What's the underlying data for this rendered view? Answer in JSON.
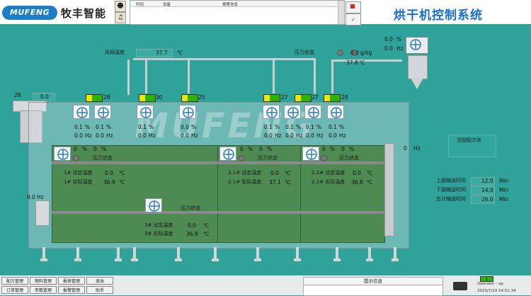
{
  "header": {
    "logo_text": "MUFENG",
    "brand_cn": "牧丰智能",
    "system_title": "烘干机控制系统",
    "alarm_columns": [
      "时间",
      "设备",
      "报警信息"
    ],
    "ack_icons": [
      "user-icon",
      "bell-icon"
    ]
  },
  "pipeline": {
    "wind_label": "风网温度",
    "wind_temp": "37.7",
    "wind_unit": "℃",
    "pressure_label": "压力状态",
    "pressure_value": "0.0",
    "pressure_unit": "g/kg",
    "exhaust_temp": "37.8",
    "exhaust_unit": "℃",
    "exhaust_pct": "0.0",
    "exhaust_hz": "0.0",
    "pct_unit": "%",
    "hz_unit": "Hz"
  },
  "feeder": {
    "id": "28",
    "value": "0.0"
  },
  "lamps": [
    {
      "num": "28"
    },
    {
      "num": "30"
    },
    {
      "num": "25"
    },
    {
      "num": "27"
    },
    {
      "num": "27"
    },
    {
      "num": "28"
    }
  ],
  "fans_top": [
    {
      "pct": "0.1",
      "hz": "0.0"
    },
    {
      "pct": "0.1",
      "hz": "0.0"
    },
    {
      "pct": "0.1",
      "hz": "0.0"
    },
    {
      "pct": "0.0",
      "hz": "0.0"
    },
    {
      "pct": "0.1",
      "hz": "0.0"
    },
    {
      "pct": "0.1",
      "hz": "0.0"
    },
    {
      "pct": "0.1",
      "hz": "0.0"
    },
    {
      "pct": "0.1",
      "hz": "0.0"
    }
  ],
  "zones": [
    {
      "fan_a": "0",
      "fan_b": "0",
      "pressure": "压力状态",
      "set_label": "1# 设定温度",
      "set": "0.0",
      "act_label": "1# 实际温度",
      "act": "36.9"
    },
    {
      "fan_a": "0",
      "fan_b": "0",
      "pressure": "压力状态",
      "set_label": "2.1# 设定温度",
      "set": "0.0",
      "act_label": "2.1# 实际温度",
      "act": "37.1"
    },
    {
      "fan_a": "0",
      "fan_b": "0",
      "pressure": "压力状态",
      "set_label": "2.2# 设定温度",
      "set": "0.0",
      "act_label": "2.2# 实际温度",
      "act": "36.8"
    }
  ],
  "zone3": {
    "pressure": "压力状态",
    "set_label": "3# 设定温度",
    "set": "0.0",
    "act_label": "3# 实际温度",
    "act": "36.8"
  },
  "lower_left": {
    "value": "0.0",
    "unit": "Hz"
  },
  "right_hz": {
    "value": "0",
    "unit": "Hz"
  },
  "recipe": {
    "title": "当前配方名",
    "rows": [
      {
        "label": "上层输送时间",
        "value": "12.0",
        "unit": "Min"
      },
      {
        "label": "下层输送时间",
        "value": "14.0",
        "unit": "Min"
      },
      {
        "label": "总计输送时间",
        "value": "26.0",
        "unit": "Min"
      }
    ]
  },
  "footer": {
    "buttons": [
      "配方管理",
      "物料管理",
      "报表管理",
      "退出",
      "订单管理",
      "参数管理",
      "报警管理",
      "助手"
    ],
    "prompt_label": "提示信息",
    "operator": "Operator : op",
    "datetime": "2023/7/19 14:51:34"
  },
  "units": {
    "c": "℃",
    "pct": "%",
    "hz": "Hz"
  },
  "colors": {
    "background": "#2fa39a",
    "title": "#1a6fc7",
    "chamber": "#4e8b52",
    "lamp_on": "#2db300"
  }
}
